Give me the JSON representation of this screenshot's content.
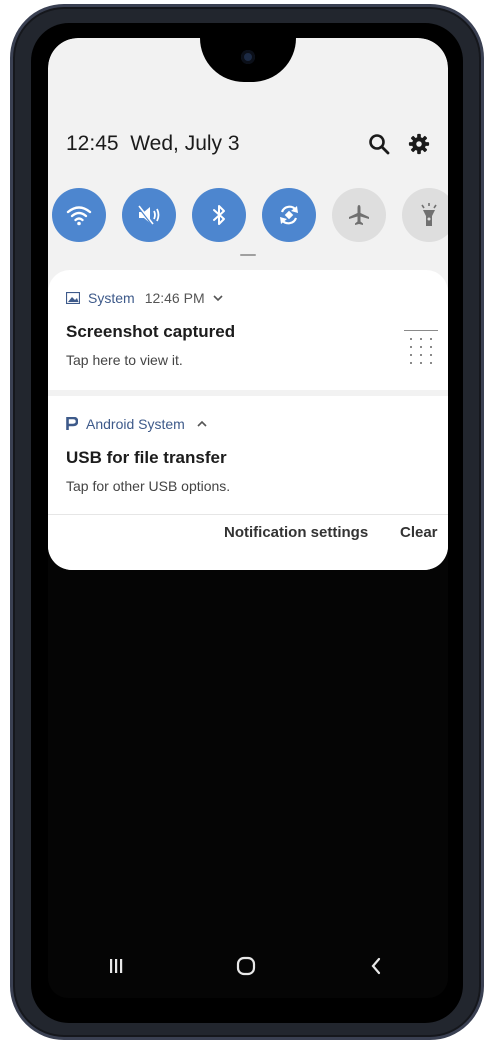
{
  "status": {
    "time": "12:45",
    "date": "Wed, July 3"
  },
  "quick_settings": [
    {
      "name": "wifi",
      "icon": "wifi-icon",
      "state": "on"
    },
    {
      "name": "sound",
      "icon": "mute-icon",
      "state": "on"
    },
    {
      "name": "bluetooth",
      "icon": "bluetooth-icon",
      "state": "on"
    },
    {
      "name": "auto-rotate",
      "icon": "rotate-icon",
      "state": "on"
    },
    {
      "name": "airplane",
      "icon": "airplane-icon",
      "state": "off"
    },
    {
      "name": "flashlight",
      "icon": "flashlight-icon",
      "state": "off"
    }
  ],
  "notifications": [
    {
      "app": "System",
      "time": "12:46 PM",
      "title": "Screenshot captured",
      "text": "Tap here to view it.",
      "icon": "image-icon",
      "expand": "chevron-down-icon"
    },
    {
      "app": "Android System",
      "title": "USB for file transfer",
      "text": "Tap for other USB options.",
      "icon": "android-system-icon",
      "expand": "chevron-up-icon"
    }
  ],
  "actions": {
    "settings": "Notification settings",
    "clear": "Clear"
  },
  "navigation": [
    "recents-icon",
    "home-icon",
    "back-icon"
  ],
  "colors": {
    "accent": "#4d86cf",
    "panel": "#f2f2f2",
    "card": "#ffffff",
    "app_name": "#3e5a8a"
  }
}
